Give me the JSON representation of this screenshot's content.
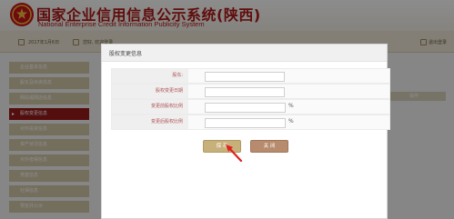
{
  "header": {
    "title": "国家企业信用信息公示系统(陕西)",
    "subtitle": "National Enterprise Credit Information Publicity System"
  },
  "infobar": {
    "item_1": "2017年1月6日",
    "item_2": "您好, 欢迎登录",
    "item_3": "退出登录"
  },
  "sidebar": {
    "items": [
      {
        "label": "企业基本信息",
        "active": false
      },
      {
        "label": "股东及出资信息",
        "active": false
      },
      {
        "label": "网站或网店信息",
        "active": false
      },
      {
        "label": "股权变更信息",
        "active": true
      },
      {
        "label": "对外投资信息",
        "active": false
      },
      {
        "label": "资产状况信息",
        "active": false
      },
      {
        "label": "对外担保信息",
        "active": false
      },
      {
        "label": "党建信息",
        "active": false
      },
      {
        "label": "社保信息",
        "active": false
      },
      {
        "label": "预览并公示",
        "active": false
      }
    ]
  },
  "table": {
    "op_header": "操作"
  },
  "modal": {
    "title": "股权变更信息",
    "fields": [
      {
        "label": "股东:",
        "value": "",
        "suffix": ""
      },
      {
        "label": "股权变更日期",
        "value": "",
        "suffix": ""
      },
      {
        "label": "变更前股权比例",
        "value": "",
        "suffix": "%"
      },
      {
        "label": "变更后股权比例",
        "value": "",
        "suffix": "%"
      }
    ],
    "save_label": "保 存",
    "close_label": "关 闭"
  },
  "colors": {
    "brand_red": "#b01818",
    "active_side": "#9a1a1a",
    "side_item": "#d4c9a8",
    "save_button": "#c8b07a",
    "close_button": "#b68b6e",
    "pointer": "#e02020"
  }
}
